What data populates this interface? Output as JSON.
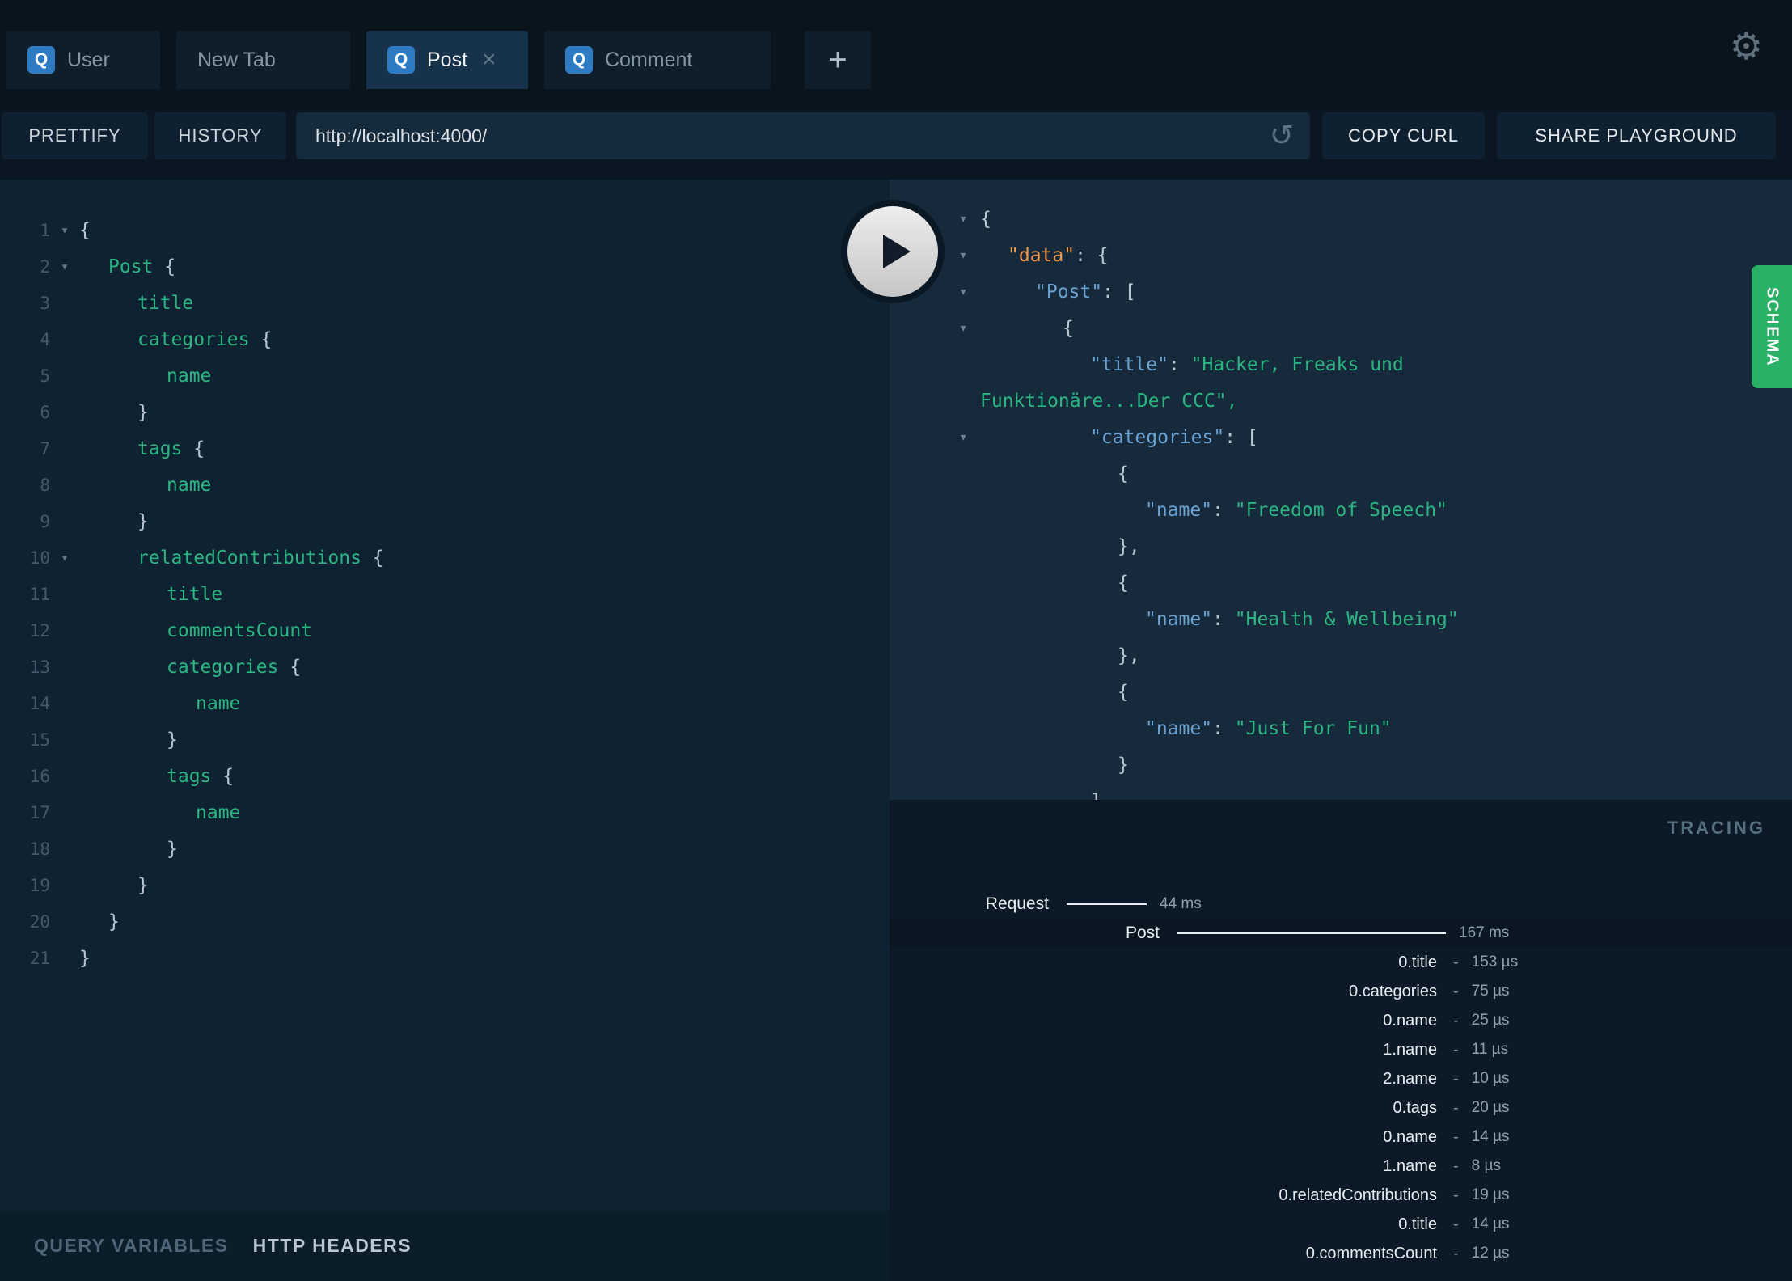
{
  "icons": {
    "gear": "⚙",
    "refresh": "↺",
    "close": "×",
    "caret_down": "▾",
    "query_badge": "Q"
  },
  "colors": {
    "accent_blue": "#2f7bc3",
    "schema_green": "#29b167",
    "field_green": "#2bb583",
    "string_green": "#2bb583",
    "key_blue": "#6ba2d4",
    "data_orange": "#f2994a",
    "punct_gray": "#bac7d2"
  },
  "tabs": {
    "items": [
      {
        "label": "User",
        "icon": "Q",
        "active": false,
        "closable": false
      },
      {
        "label": "New Tab",
        "icon": null,
        "active": false,
        "closable": false
      },
      {
        "label": "Post",
        "icon": "Q",
        "active": true,
        "closable": true
      },
      {
        "label": "Comment",
        "icon": "Q",
        "active": false,
        "closable": false
      }
    ],
    "new_tab_label": "+"
  },
  "toolbar": {
    "prettify_label": "PRETTIFY",
    "history_label": "HISTORY",
    "url_value": "http://localhost:4000/",
    "copy_curl_label": "COPY CURL",
    "share_label": "SHARE PLAYGROUND"
  },
  "query_editor": {
    "lines": [
      {
        "n": 1,
        "fold": true,
        "indent": 0,
        "tokens": [
          [
            "{",
            "p"
          ]
        ]
      },
      {
        "n": 2,
        "fold": true,
        "indent": 1,
        "tokens": [
          [
            "Post ",
            "f"
          ],
          [
            "{",
            "p"
          ]
        ]
      },
      {
        "n": 3,
        "fold": false,
        "indent": 2,
        "tokens": [
          [
            "title",
            "f"
          ]
        ]
      },
      {
        "n": 4,
        "fold": false,
        "indent": 2,
        "tokens": [
          [
            "categories ",
            "f"
          ],
          [
            "{",
            "p"
          ]
        ]
      },
      {
        "n": 5,
        "fold": false,
        "indent": 3,
        "tokens": [
          [
            "name",
            "f"
          ]
        ]
      },
      {
        "n": 6,
        "fold": false,
        "indent": 2,
        "tokens": [
          [
            "}",
            "p"
          ]
        ]
      },
      {
        "n": 7,
        "fold": false,
        "indent": 2,
        "tokens": [
          [
            "tags ",
            "f"
          ],
          [
            "{",
            "p"
          ]
        ]
      },
      {
        "n": 8,
        "fold": false,
        "indent": 3,
        "tokens": [
          [
            "name",
            "f"
          ]
        ]
      },
      {
        "n": 9,
        "fold": false,
        "indent": 2,
        "tokens": [
          [
            "}",
            "p"
          ]
        ]
      },
      {
        "n": 10,
        "fold": true,
        "indent": 2,
        "tokens": [
          [
            "relatedContributions ",
            "f"
          ],
          [
            "{",
            "p"
          ]
        ]
      },
      {
        "n": 11,
        "fold": false,
        "indent": 3,
        "tokens": [
          [
            "title",
            "f"
          ]
        ]
      },
      {
        "n": 12,
        "fold": false,
        "indent": 3,
        "tokens": [
          [
            "commentsCount",
            "f"
          ]
        ]
      },
      {
        "n": 13,
        "fold": false,
        "indent": 3,
        "tokens": [
          [
            "categories ",
            "f"
          ],
          [
            "{",
            "p"
          ]
        ]
      },
      {
        "n": 14,
        "fold": false,
        "indent": 4,
        "tokens": [
          [
            "name",
            "f"
          ]
        ]
      },
      {
        "n": 15,
        "fold": false,
        "indent": 3,
        "tokens": [
          [
            "}",
            "p"
          ]
        ]
      },
      {
        "n": 16,
        "fold": false,
        "indent": 3,
        "tokens": [
          [
            "tags ",
            "f"
          ],
          [
            "{",
            "p"
          ]
        ]
      },
      {
        "n": 17,
        "fold": false,
        "indent": 4,
        "tokens": [
          [
            "name",
            "f"
          ]
        ]
      },
      {
        "n": 18,
        "fold": false,
        "indent": 3,
        "tokens": [
          [
            "}",
            "p"
          ]
        ]
      },
      {
        "n": 19,
        "fold": false,
        "indent": 2,
        "tokens": [
          [
            "}",
            "p"
          ]
        ]
      },
      {
        "n": 20,
        "fold": false,
        "indent": 1,
        "tokens": [
          [
            "}",
            "p"
          ]
        ]
      },
      {
        "n": 21,
        "fold": false,
        "indent": 0,
        "tokens": [
          [
            "}",
            "p"
          ]
        ]
      }
    ]
  },
  "response_viewer": {
    "lines": [
      {
        "caret": true,
        "indent": 0,
        "tokens": [
          [
            "{",
            "p"
          ]
        ]
      },
      {
        "caret": true,
        "indent": 1,
        "tokens": [
          [
            "\"data\"",
            "k1"
          ],
          [
            ": {",
            "p"
          ]
        ]
      },
      {
        "caret": true,
        "indent": 2,
        "tokens": [
          [
            "\"Post\"",
            "k2"
          ],
          [
            ": [",
            "p"
          ]
        ]
      },
      {
        "caret": true,
        "indent": 3,
        "tokens": [
          [
            "{",
            "p"
          ]
        ]
      },
      {
        "caret": false,
        "indent": 4,
        "tokens": [
          [
            "\"title\"",
            "k2"
          ],
          [
            ": ",
            "p"
          ],
          [
            "\"Hacker, Freaks und",
            "s"
          ]
        ]
      },
      {
        "caret": false,
        "indent": 0,
        "tokens": [
          [
            "Funktionäre...Der CCC\",",
            "s"
          ]
        ]
      },
      {
        "caret": true,
        "indent": 4,
        "tokens": [
          [
            "\"categories\"",
            "k2"
          ],
          [
            ": [",
            "p"
          ]
        ]
      },
      {
        "caret": false,
        "indent": 5,
        "tokens": [
          [
            "{",
            "p"
          ]
        ]
      },
      {
        "caret": false,
        "indent": 6,
        "tokens": [
          [
            "\"name\"",
            "k2"
          ],
          [
            ": ",
            "p"
          ],
          [
            "\"Freedom of Speech\"",
            "s"
          ]
        ]
      },
      {
        "caret": false,
        "indent": 5,
        "tokens": [
          [
            "},",
            "p"
          ]
        ]
      },
      {
        "caret": false,
        "indent": 5,
        "tokens": [
          [
            "{",
            "p"
          ]
        ]
      },
      {
        "caret": false,
        "indent": 6,
        "tokens": [
          [
            "\"name\"",
            "k2"
          ],
          [
            ": ",
            "p"
          ],
          [
            "\"Health & Wellbeing\"",
            "s"
          ]
        ]
      },
      {
        "caret": false,
        "indent": 5,
        "tokens": [
          [
            "},",
            "p"
          ]
        ]
      },
      {
        "caret": false,
        "indent": 5,
        "tokens": [
          [
            "{",
            "p"
          ]
        ]
      },
      {
        "caret": false,
        "indent": 6,
        "tokens": [
          [
            "\"name\"",
            "k2"
          ],
          [
            ": ",
            "p"
          ],
          [
            "\"Just For Fun\"",
            "s"
          ]
        ]
      },
      {
        "caret": false,
        "indent": 5,
        "tokens": [
          [
            "}",
            "p"
          ]
        ]
      },
      {
        "caret": false,
        "indent": 4,
        "tokens": [
          [
            "]",
            "p"
          ]
        ]
      }
    ]
  },
  "tracing": {
    "title": "TRACING",
    "rows": [
      {
        "label": "Request",
        "value": "44 ms",
        "kind": "request"
      },
      {
        "label": "Post",
        "value": "167 ms",
        "kind": "root"
      },
      {
        "label": "0.title",
        "value": "153 µs",
        "kind": "field"
      },
      {
        "label": "0.categories",
        "value": "75 µs",
        "kind": "field"
      },
      {
        "label": "0.name",
        "value": "25 µs",
        "kind": "field"
      },
      {
        "label": "1.name",
        "value": "11 µs",
        "kind": "field"
      },
      {
        "label": "2.name",
        "value": "10 µs",
        "kind": "field"
      },
      {
        "label": "0.tags",
        "value": "20 µs",
        "kind": "field"
      },
      {
        "label": "0.name",
        "value": "14 µs",
        "kind": "field"
      },
      {
        "label": "1.name",
        "value": "8 µs",
        "kind": "field"
      },
      {
        "label": "0.relatedContributions",
        "value": "19 µs",
        "kind": "field"
      },
      {
        "label": "0.title",
        "value": "14 µs",
        "kind": "field"
      },
      {
        "label": "0.commentsCount",
        "value": "12 µs",
        "kind": "field"
      }
    ]
  },
  "footer": {
    "query_variables_label": "QUERY VARIABLES",
    "http_headers_label": "HTTP HEADERS"
  },
  "schema_tab_label": "SCHEMA"
}
